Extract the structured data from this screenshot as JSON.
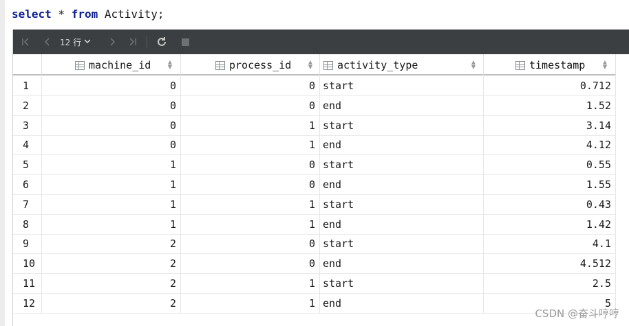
{
  "editor": {
    "keyword_select": "select",
    "star": " * ",
    "keyword_from": "from",
    "table_clause": " Activity;"
  },
  "toolbar": {
    "first_icon": "first-page-icon",
    "prev_icon": "previous-page-icon",
    "row_count": "12 行",
    "next_icon": "next-page-icon",
    "last_icon": "last-page-icon",
    "refresh_icon": "refresh-icon",
    "stop_icon": "stop-icon"
  },
  "table": {
    "columns": [
      "machine_id",
      "process_id",
      "activity_type",
      "timestamp"
    ],
    "rows": [
      {
        "n": "1",
        "machine_id": "0",
        "process_id": "0",
        "activity_type": "start",
        "timestamp": "0.712"
      },
      {
        "n": "2",
        "machine_id": "0",
        "process_id": "0",
        "activity_type": "end",
        "timestamp": "1.52"
      },
      {
        "n": "3",
        "machine_id": "0",
        "process_id": "1",
        "activity_type": "start",
        "timestamp": "3.14"
      },
      {
        "n": "4",
        "machine_id": "0",
        "process_id": "1",
        "activity_type": "end",
        "timestamp": "4.12"
      },
      {
        "n": "5",
        "machine_id": "1",
        "process_id": "0",
        "activity_type": "start",
        "timestamp": "0.55"
      },
      {
        "n": "6",
        "machine_id": "1",
        "process_id": "0",
        "activity_type": "end",
        "timestamp": "1.55"
      },
      {
        "n": "7",
        "machine_id": "1",
        "process_id": "1",
        "activity_type": "start",
        "timestamp": "0.43"
      },
      {
        "n": "8",
        "machine_id": "1",
        "process_id": "1",
        "activity_type": "end",
        "timestamp": "1.42"
      },
      {
        "n": "9",
        "machine_id": "2",
        "process_id": "0",
        "activity_type": "start",
        "timestamp": "4.1"
      },
      {
        "n": "10",
        "machine_id": "2",
        "process_id": "0",
        "activity_type": "end",
        "timestamp": "4.512"
      },
      {
        "n": "11",
        "machine_id": "2",
        "process_id": "1",
        "activity_type": "start",
        "timestamp": "2.5"
      },
      {
        "n": "12",
        "machine_id": "2",
        "process_id": "1",
        "activity_type": "end",
        "timestamp": "5"
      }
    ]
  },
  "watermark": "CSDN @奋斗哼哼",
  "colors": {
    "toolbar_bg": "#3c3f41",
    "keyword": "#0b1f8f"
  }
}
